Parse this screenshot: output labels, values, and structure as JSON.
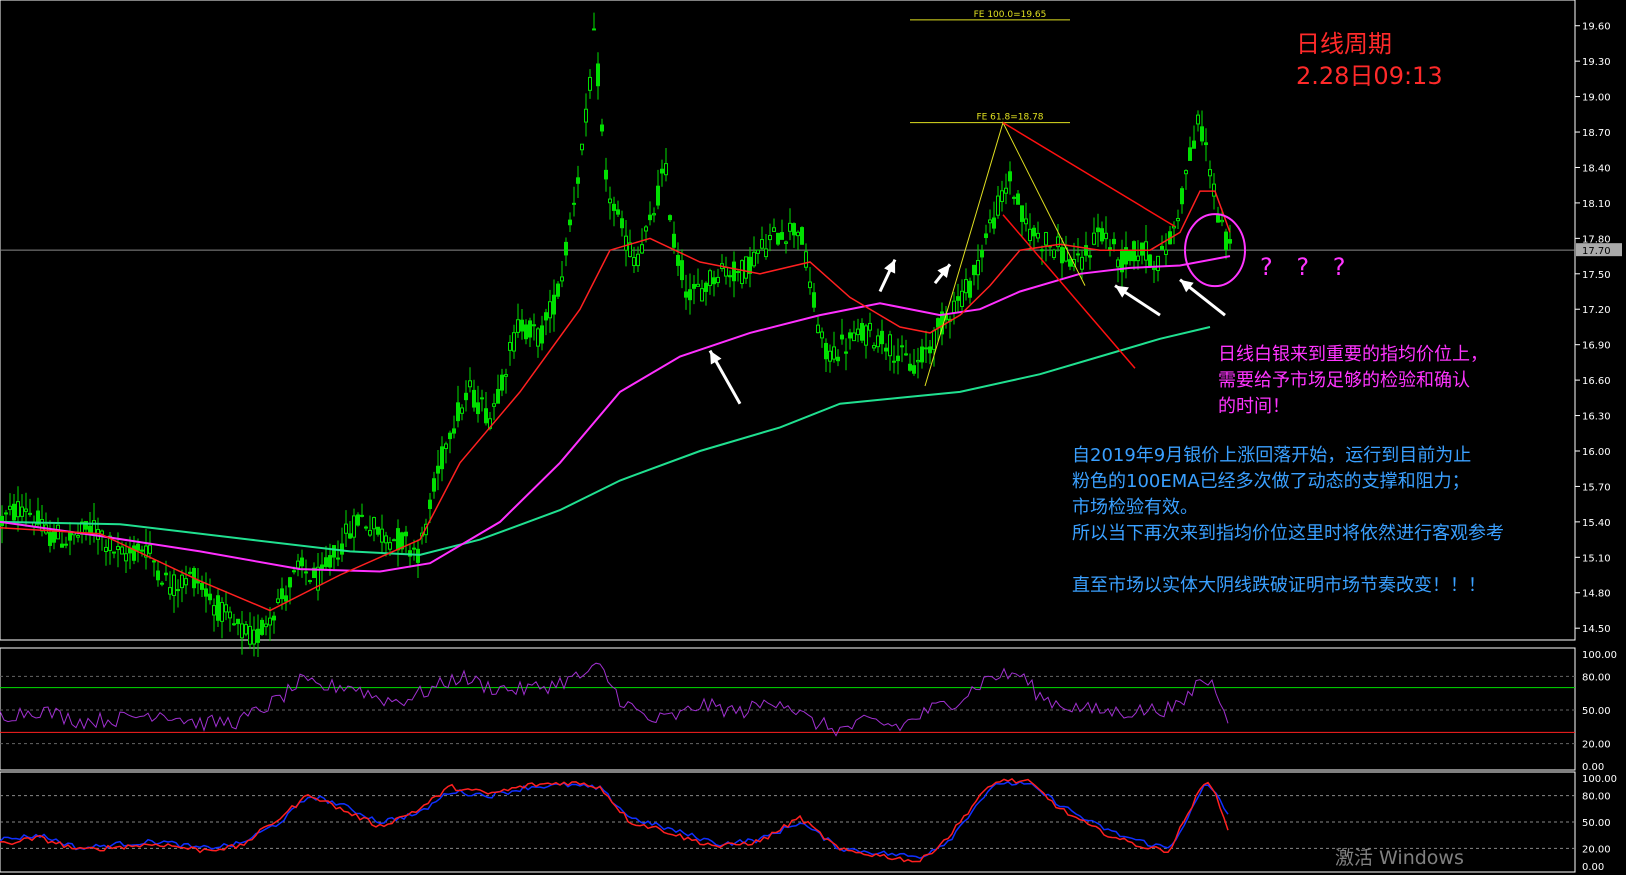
{
  "annotations": {
    "title_line1": "日线周期",
    "title_line2": "2.28日09:13",
    "question_marks": "? ? ?",
    "pink_note": [
      "日线白银来到重要的指均价位上，",
      "需要给予市场足够的检验和确认",
      "的时间！"
    ],
    "blue_note": [
      "自2019年9月银价上涨回落开始，运行到目前为止",
      "粉色的100EMA已经多次做了动态的支撑和阻力；",
      "市场检验有效。",
      "所以当下再次来到指均价位这里时将依然进行客观参考",
      "",
      "直至市场以实体大阴线跌破证明市场节奏改变！！！"
    ],
    "watermark": "激活 Windows"
  },
  "chart_data": [
    {
      "type": "line",
      "panel": "main",
      "y_ticks": [
        "19.60",
        "19.30",
        "19.00",
        "18.70",
        "18.40",
        "18.10",
        "17.80",
        "17.50",
        "17.20",
        "16.90",
        "16.60",
        "16.30",
        "16.00",
        "15.70",
        "15.40",
        "15.10",
        "14.80",
        "14.50"
      ],
      "ylim": [
        14.4,
        19.75
      ],
      "current_price_label": "17.70",
      "current_price": 17.7,
      "fib_levels": [
        {
          "label": "FE 100.0=19.65",
          "value": 19.65
        },
        {
          "label": "FE 61.8=18.78",
          "value": 18.78
        }
      ],
      "colors": {
        "candle": "#00e000",
        "ema_fast": "#ff2020",
        "ema_100": "#ff30ff",
        "ema_slow": "#20e090",
        "trend": "#ff1010",
        "fib": "#e0e020"
      },
      "price_path": [
        [
          0,
          15.4
        ],
        [
          25,
          15.55
        ],
        [
          45,
          15.3
        ],
        [
          70,
          15.25
        ],
        [
          95,
          15.35
        ],
        [
          120,
          15.1
        ],
        [
          145,
          15.2
        ],
        [
          170,
          14.85
        ],
        [
          195,
          14.95
        ],
        [
          215,
          14.7
        ],
        [
          235,
          14.5
        ],
        [
          255,
          14.4
        ],
        [
          268,
          14.6
        ],
        [
          285,
          14.8
        ],
        [
          300,
          15.0
        ],
        [
          320,
          14.9
        ],
        [
          340,
          15.2
        ],
        [
          360,
          15.45
        ],
        [
          380,
          15.3
        ],
        [
          400,
          15.25
        ],
        [
          420,
          15.15
        ],
        [
          435,
          15.7
        ],
        [
          450,
          16.2
        ],
        [
          470,
          16.5
        ],
        [
          490,
          16.3
        ],
        [
          505,
          16.7
        ],
        [
          520,
          17.1
        ],
        [
          540,
          16.95
        ],
        [
          560,
          17.4
        ],
        [
          575,
          18.2
        ],
        [
          585,
          18.7
        ],
        [
          595,
          19.55
        ],
        [
          605,
          18.3
        ],
        [
          620,
          17.9
        ],
        [
          635,
          17.6
        ],
        [
          650,
          17.9
        ],
        [
          665,
          18.4
        ],
        [
          675,
          17.7
        ],
        [
          690,
          17.3
        ],
        [
          705,
          17.4
        ],
        [
          720,
          17.55
        ],
        [
          740,
          17.5
        ],
        [
          760,
          17.7
        ],
        [
          780,
          17.85
        ],
        [
          800,
          17.9
        ],
        [
          810,
          17.4
        ],
        [
          825,
          16.8
        ],
        [
          845,
          16.9
        ],
        [
          865,
          17.0
        ],
        [
          885,
          16.95
        ],
        [
          900,
          16.8
        ],
        [
          915,
          16.7
        ],
        [
          930,
          16.9
        ],
        [
          950,
          17.2
        ],
        [
          970,
          17.4
        ],
        [
          990,
          17.9
        ],
        [
          1010,
          18.3
        ],
        [
          1025,
          17.9
        ],
        [
          1040,
          17.8
        ],
        [
          1060,
          17.7
        ],
        [
          1080,
          17.55
        ],
        [
          1100,
          17.9
        ],
        [
          1120,
          17.6
        ],
        [
          1140,
          17.7
        ],
        [
          1160,
          17.6
        ],
        [
          1175,
          17.9
        ],
        [
          1190,
          18.5
        ],
        [
          1200,
          18.8
        ],
        [
          1210,
          18.4
        ],
        [
          1220,
          17.9
        ],
        [
          1230,
          17.7
        ]
      ],
      "ema_fast": [
        [
          0,
          15.35
        ],
        [
          100,
          15.3
        ],
        [
          200,
          14.9
        ],
        [
          270,
          14.65
        ],
        [
          340,
          14.95
        ],
        [
          420,
          15.25
        ],
        [
          460,
          15.9
        ],
        [
          520,
          16.5
        ],
        [
          580,
          17.2
        ],
        [
          610,
          17.7
        ],
        [
          650,
          17.8
        ],
        [
          700,
          17.6
        ],
        [
          760,
          17.5
        ],
        [
          810,
          17.6
        ],
        [
          850,
          17.3
        ],
        [
          900,
          17.05
        ],
        [
          930,
          17.0
        ],
        [
          960,
          17.15
        ],
        [
          990,
          17.4
        ],
        [
          1020,
          17.7
        ],
        [
          1060,
          17.75
        ],
        [
          1100,
          17.7
        ],
        [
          1150,
          17.7
        ],
        [
          1180,
          17.85
        ],
        [
          1200,
          18.2
        ],
        [
          1215,
          18.2
        ],
        [
          1230,
          17.85
        ]
      ],
      "ema_100": [
        [
          0,
          15.4
        ],
        [
          100,
          15.28
        ],
        [
          200,
          15.15
        ],
        [
          300,
          15.0
        ],
        [
          380,
          14.98
        ],
        [
          430,
          15.05
        ],
        [
          500,
          15.4
        ],
        [
          560,
          15.9
        ],
        [
          620,
          16.5
        ],
        [
          680,
          16.8
        ],
        [
          750,
          17.0
        ],
        [
          820,
          17.15
        ],
        [
          880,
          17.25
        ],
        [
          940,
          17.15
        ],
        [
          980,
          17.2
        ],
        [
          1020,
          17.35
        ],
        [
          1080,
          17.5
        ],
        [
          1130,
          17.55
        ],
        [
          1180,
          17.57
        ],
        [
          1230,
          17.65
        ]
      ],
      "ema_slow": [
        [
          0,
          15.4
        ],
        [
          120,
          15.38
        ],
        [
          250,
          15.25
        ],
        [
          350,
          15.15
        ],
        [
          420,
          15.12
        ],
        [
          480,
          15.25
        ],
        [
          560,
          15.5
        ],
        [
          620,
          15.75
        ],
        [
          700,
          16.0
        ],
        [
          780,
          16.2
        ],
        [
          840,
          16.4
        ],
        [
          900,
          16.45
        ],
        [
          960,
          16.5
        ],
        [
          1040,
          16.65
        ],
        [
          1100,
          16.8
        ],
        [
          1160,
          16.95
        ],
        [
          1210,
          17.05
        ]
      ]
    },
    {
      "type": "line",
      "panel": "oscillator_1",
      "y_ticks": [
        "100.00",
        "80.00",
        "50.00",
        "20.00",
        "0.00"
      ],
      "ylim": [
        0,
        100
      ],
      "levels": [
        {
          "value": 70,
          "color": "#00e000"
        },
        {
          "value": 30,
          "color": "#ff2020"
        }
      ],
      "colors": {
        "line": "#a030d0"
      },
      "values": [
        [
          0,
          45
        ],
        [
          40,
          50
        ],
        [
          80,
          40
        ],
        [
          120,
          42
        ],
        [
          160,
          48
        ],
        [
          200,
          38
        ],
        [
          240,
          40
        ],
        [
          280,
          60
        ],
        [
          300,
          75
        ],
        [
          320,
          70
        ],
        [
          350,
          72
        ],
        [
          380,
          60
        ],
        [
          400,
          58
        ],
        [
          430,
          68
        ],
        [
          460,
          80
        ],
        [
          490,
          70
        ],
        [
          520,
          68
        ],
        [
          550,
          72
        ],
        [
          580,
          80
        ],
        [
          600,
          88
        ],
        [
          620,
          60
        ],
        [
          650,
          40
        ],
        [
          680,
          45
        ],
        [
          700,
          55
        ],
        [
          740,
          48
        ],
        [
          780,
          60
        ],
        [
          810,
          40
        ],
        [
          840,
          32
        ],
        [
          870,
          40
        ],
        [
          900,
          35
        ],
        [
          930,
          50
        ],
        [
          960,
          60
        ],
        [
          990,
          80
        ],
        [
          1020,
          82
        ],
        [
          1040,
          62
        ],
        [
          1060,
          55
        ],
        [
          1090,
          50
        ],
        [
          1120,
          48
        ],
        [
          1150,
          50
        ],
        [
          1180,
          52
        ],
        [
          1200,
          78
        ],
        [
          1215,
          72
        ],
        [
          1230,
          40
        ]
      ]
    },
    {
      "type": "line",
      "panel": "oscillator_2",
      "y_ticks": [
        "100.00",
        "80.00",
        "50.00",
        "20.00",
        "0.00"
      ],
      "ylim": [
        0,
        100
      ],
      "colors": {
        "main": "#1030ff",
        "signal": "#ff2020"
      },
      "main": [
        [
          0,
          30
        ],
        [
          40,
          35
        ],
        [
          80,
          20
        ],
        [
          120,
          25
        ],
        [
          160,
          28
        ],
        [
          200,
          20
        ],
        [
          240,
          25
        ],
        [
          280,
          50
        ],
        [
          310,
          80
        ],
        [
          340,
          70
        ],
        [
          380,
          50
        ],
        [
          420,
          60
        ],
        [
          450,
          85
        ],
        [
          490,
          80
        ],
        [
          530,
          90
        ],
        [
          570,
          92
        ],
        [
          600,
          88
        ],
        [
          630,
          55
        ],
        [
          660,
          45
        ],
        [
          690,
          35
        ],
        [
          720,
          25
        ],
        [
          760,
          30
        ],
        [
          800,
          50
        ],
        [
          840,
          20
        ],
        [
          880,
          15
        ],
        [
          920,
          10
        ],
        [
          950,
          30
        ],
        [
          980,
          75
        ],
        [
          1000,
          95
        ],
        [
          1030,
          92
        ],
        [
          1060,
          70
        ],
        [
          1090,
          50
        ],
        [
          1120,
          35
        ],
        [
          1150,
          25
        ],
        [
          1170,
          20
        ],
        [
          1190,
          60
        ],
        [
          1205,
          92
        ],
        [
          1215,
          85
        ],
        [
          1230,
          55
        ]
      ],
      "signal": [
        [
          0,
          25
        ],
        [
          40,
          32
        ],
        [
          80,
          18
        ],
        [
          120,
          22
        ],
        [
          160,
          25
        ],
        [
          200,
          18
        ],
        [
          240,
          22
        ],
        [
          280,
          55
        ],
        [
          310,
          82
        ],
        [
          340,
          65
        ],
        [
          380,
          45
        ],
        [
          420,
          65
        ],
        [
          450,
          90
        ],
        [
          490,
          82
        ],
        [
          530,
          92
        ],
        [
          570,
          95
        ],
        [
          600,
          90
        ],
        [
          630,
          50
        ],
        [
          660,
          42
        ],
        [
          690,
          30
        ],
        [
          720,
          22
        ],
        [
          760,
          28
        ],
        [
          800,
          55
        ],
        [
          840,
          18
        ],
        [
          880,
          12
        ],
        [
          920,
          5
        ],
        [
          950,
          35
        ],
        [
          980,
          80
        ],
        [
          1000,
          98
        ],
        [
          1030,
          95
        ],
        [
          1060,
          65
        ],
        [
          1090,
          45
        ],
        [
          1120,
          30
        ],
        [
          1150,
          20
        ],
        [
          1170,
          18
        ],
        [
          1190,
          65
        ],
        [
          1205,
          95
        ],
        [
          1215,
          88
        ],
        [
          1230,
          30
        ]
      ]
    }
  ]
}
